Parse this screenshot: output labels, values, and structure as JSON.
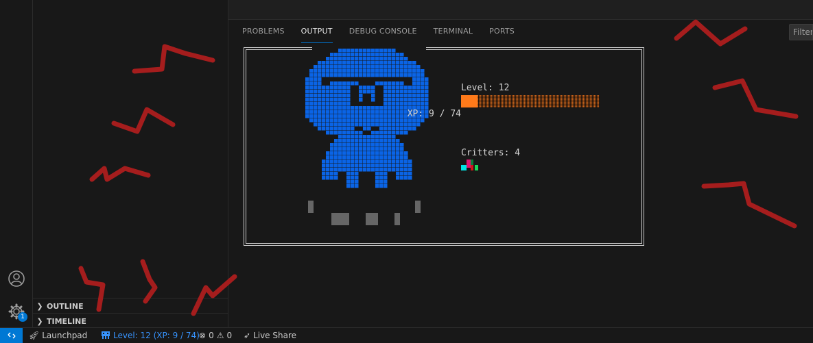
{
  "panel": {
    "tabs": [
      {
        "label": "PROBLEMS"
      },
      {
        "label": "OUTPUT"
      },
      {
        "label": "DEBUG CONSOLE"
      },
      {
        "label": "TERMINAL"
      },
      {
        "label": "PORTS"
      }
    ],
    "filter_placeholder": "Filter"
  },
  "pet": {
    "level_label": "Level: 12",
    "xp_text": "XP: 9 / 74",
    "xp_fraction": 0.12,
    "critters_label": "Critters: 4",
    "body_color": "#0a64e6",
    "xp_color": "#ff7a1a"
  },
  "sidebar": {
    "sections": [
      {
        "label": "OUTLINE"
      },
      {
        "label": "TIMELINE"
      }
    ]
  },
  "activity": {
    "settings_badge": "1"
  },
  "status": {
    "launchpad": "Launchpad",
    "pet_level": "Level: 12 (XP: 9 / 74)",
    "errors": "0",
    "warnings": "0",
    "live_share": "Live Share"
  },
  "colors": {
    "accent": "#0078d4",
    "scribble": "#a51d1d"
  }
}
